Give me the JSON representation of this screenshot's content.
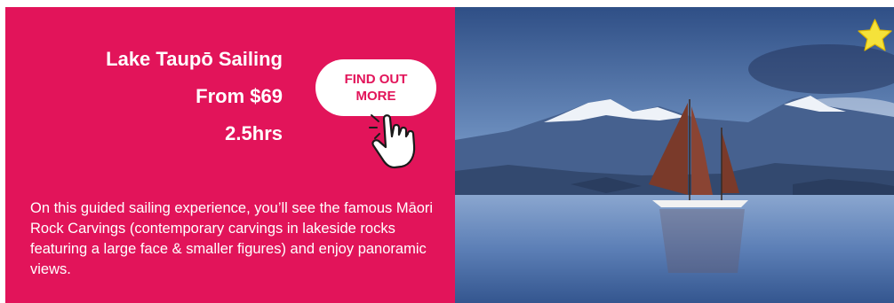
{
  "tour": {
    "title": "Lake Taupō Sailing",
    "price": "From $69",
    "duration": "2.5hrs",
    "description": "On this guided sailing experience, you’ll see the famous Māori Rock Carvings (contemporary carvings in lakeside rocks featuring a large face & smaller figures) and enjoy panoramic views."
  },
  "cta": {
    "label": "FIND OUT MORE"
  },
  "colors": {
    "accent": "#e2145a",
    "text_on_accent": "#ffffff",
    "star": "#f5e23a"
  },
  "icons": {
    "pointer": "hand-pointer-icon",
    "favorite": "star-icon"
  }
}
